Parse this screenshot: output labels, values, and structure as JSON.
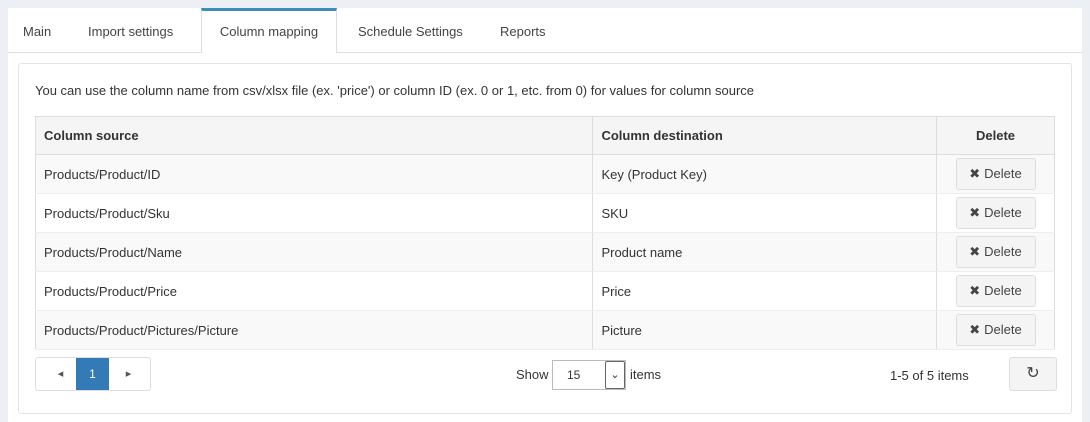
{
  "tabs": [
    "Main",
    "Import settings",
    "Column mapping",
    "Schedule Settings",
    "Reports"
  ],
  "active_tab": "Column mapping",
  "note": "You can use the column name from csv/xlsx file (ex. 'price') or column ID (ex. 0 or 1, etc. from 0) for values for column source",
  "grid": {
    "headers": [
      "Column source",
      "Column destination",
      "Delete"
    ],
    "rows": [
      {
        "source": "Products/Product/ID",
        "destination": "Key (Product Key)",
        "action": "Delete"
      },
      {
        "source": "Products/Product/Sku",
        "destination": "SKU",
        "action": "Delete"
      },
      {
        "source": "Products/Product/Name",
        "destination": "Product name",
        "action": "Delete"
      },
      {
        "source": "Products/Product/Price",
        "destination": "Price",
        "action": "Delete"
      },
      {
        "source": "Products/Product/Pictures/Picture",
        "destination": "Picture",
        "action": "Delete"
      }
    ]
  },
  "pager": {
    "prev": "◂",
    "current": "1",
    "next": "▸"
  },
  "show_label": "Show",
  "page_size": "15",
  "items_label": "items",
  "count_text": "1-5 of 5 items",
  "icons": {
    "delete": "times-icon",
    "refresh": "refresh-icon"
  },
  "colors": {
    "accent": "#3c8dbc",
    "page_active": "#337ab7"
  }
}
